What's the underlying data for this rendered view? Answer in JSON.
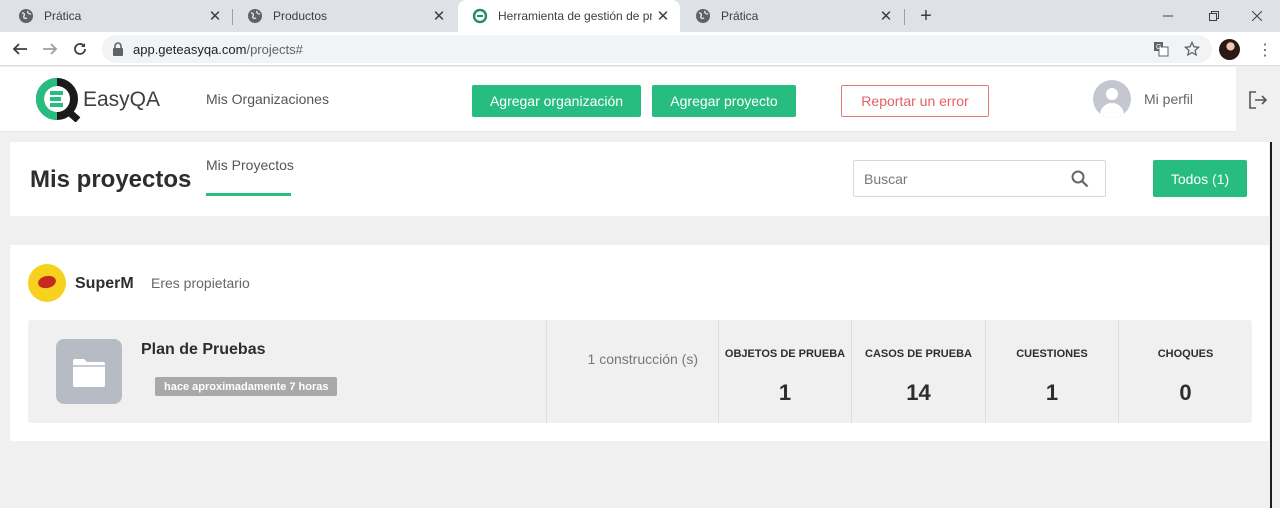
{
  "browser": {
    "tabs": [
      {
        "title": "Prática",
        "active": false
      },
      {
        "title": "Productos",
        "active": false
      },
      {
        "title": "Herramienta de gestión de prueb",
        "active": true
      },
      {
        "title": "Prática",
        "active": false
      }
    ],
    "new_tab_icon": "plus-icon",
    "url_host": "app.geteasyqa.com",
    "url_path": "/projects#"
  },
  "header": {
    "logo_text": "EasyQA",
    "nav_organizations": "Mis Organizaciones",
    "add_organization": "Agregar organización",
    "add_project": "Agregar proyecto",
    "report_error": "Reportar un error",
    "profile": "Mi perfil",
    "accent_color": "#27bc80",
    "error_color": "#e56063"
  },
  "title_bar": {
    "title": "Mis proyectos",
    "tab_my_projects": "Mis Proyectos",
    "search_placeholder": "Buscar",
    "filter_all": "Todos (1)"
  },
  "organization": {
    "name": "SuperM",
    "role": "Eres propietario",
    "projects": [
      {
        "name": "Plan de Pruebas",
        "time": "hace aproximadamente 7 horas",
        "builds": "1 construcción (s)",
        "stats": [
          {
            "label": "OBJETOS DE PRUEBA",
            "value": "1"
          },
          {
            "label": "CASOS DE PRUEBA",
            "value": "14"
          },
          {
            "label": "CUESTIONES",
            "value": "1"
          },
          {
            "label": "CHOQUES",
            "value": "0"
          }
        ]
      }
    ]
  }
}
